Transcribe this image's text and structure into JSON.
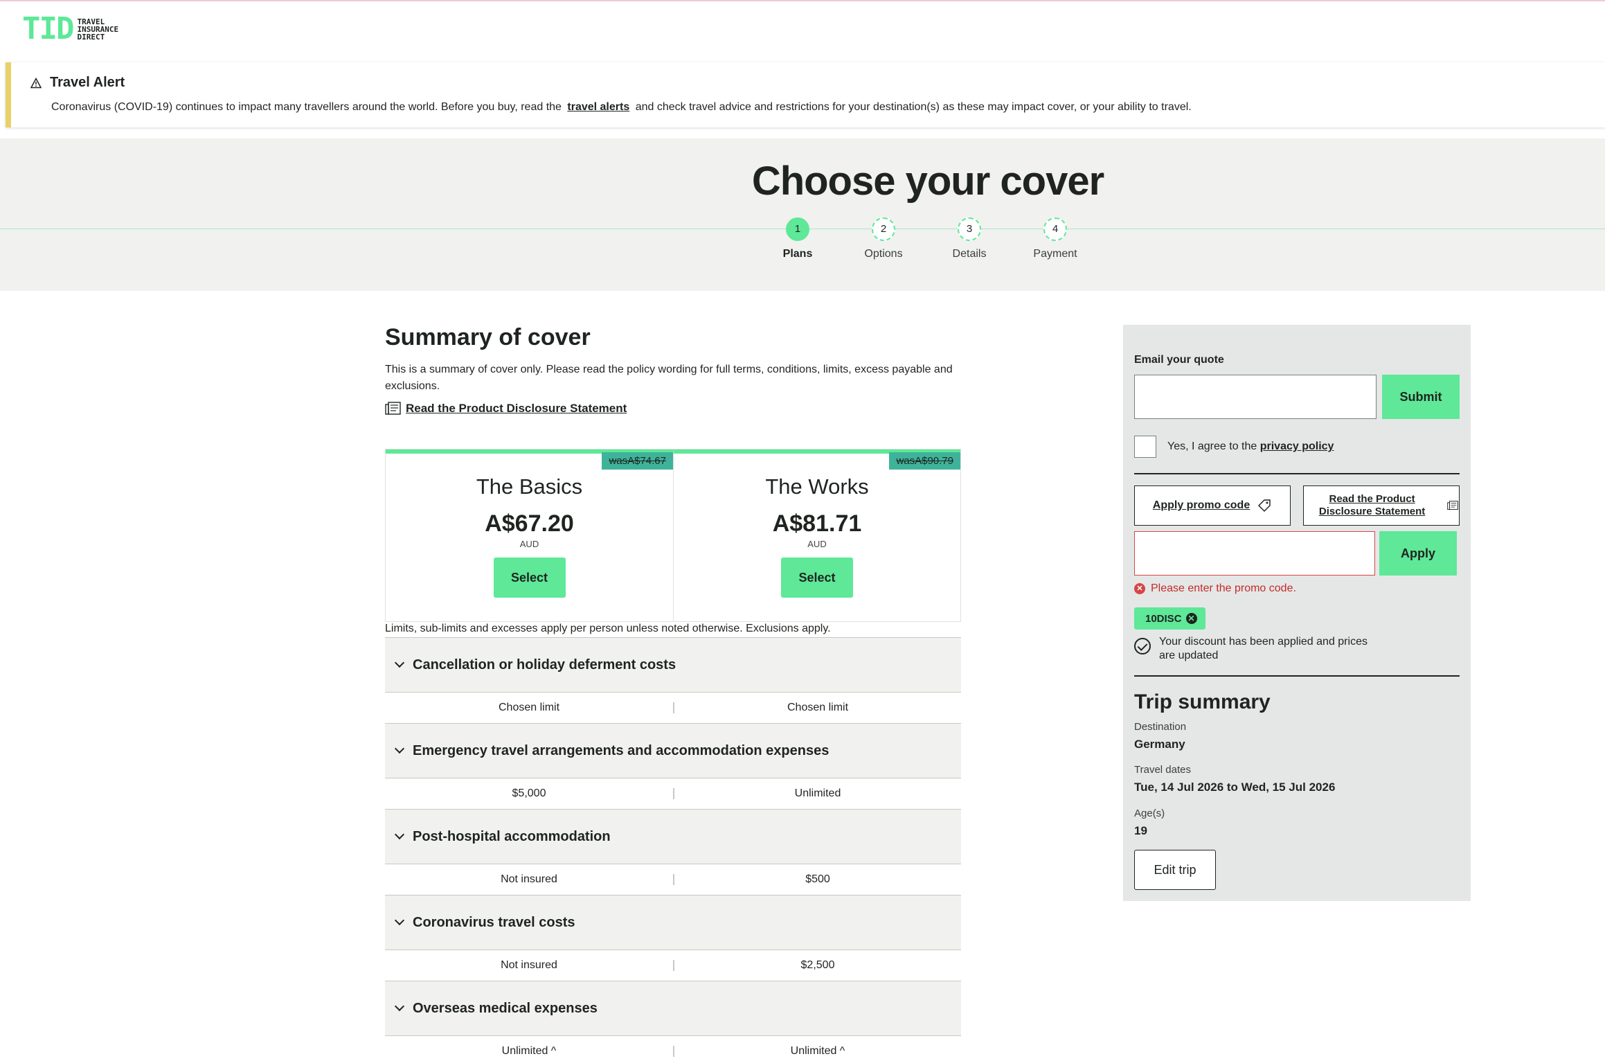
{
  "logo": {
    "mark": "TID",
    "line1": "TRAVEL",
    "line2": "INSURANCE",
    "line3": "DIRECT"
  },
  "alert": {
    "title": "Travel Alert",
    "text_before": "Coronavirus (COVID-19) continues to impact many travellers around the world. Before you buy, read the",
    "link": "travel alerts",
    "text_after": "and check travel advice and restrictions for your destination(s) as these may impact cover, or your ability to travel."
  },
  "page_title": "Choose your cover",
  "steps": [
    {
      "num": "1",
      "label": "Plans"
    },
    {
      "num": "2",
      "label": "Options"
    },
    {
      "num": "3",
      "label": "Details"
    },
    {
      "num": "4",
      "label": "Payment"
    }
  ],
  "summary": {
    "title": "Summary of cover",
    "text": "This is a summary of cover only. Please read the policy wording for full terms, conditions, limits, excess payable and exclusions.",
    "pds_link": "Read the Product Disclosure Statement"
  },
  "plans": [
    {
      "was": "wasA$74.67",
      "name": "The Basics",
      "price": "A$67.20",
      "currency": "AUD",
      "select": "Select"
    },
    {
      "was": "wasA$90.79",
      "name": "The Works",
      "price": "A$81.71",
      "currency": "AUD",
      "select": "Select"
    }
  ],
  "limits_note": "Limits, sub-limits and excesses apply per person unless noted otherwise. Exclusions apply.",
  "cover_items": [
    {
      "title": "Cancellation or holiday deferment costs",
      "basics": "Chosen limit",
      "works": "Chosen limit"
    },
    {
      "title": "Emergency travel arrangements and accommodation expenses",
      "basics": "$5,000",
      "works": "Unlimited"
    },
    {
      "title": "Post-hospital accommodation",
      "basics": "Not insured",
      "works": "$500"
    },
    {
      "title": "Coronavirus travel costs",
      "basics": "Not insured",
      "works": "$2,500"
    },
    {
      "title": "Overseas medical expenses",
      "basics": "Unlimited ^",
      "works": "Unlimited ^"
    }
  ],
  "sidebar": {
    "email_label": "Email your quote",
    "submit": "Submit",
    "agree_text": "Yes, I agree to the",
    "privacy_link": "privacy policy",
    "promo_button": "Apply promo code",
    "pds_button": "Read the Product Disclosure Statement",
    "apply": "Apply",
    "error": "Please enter the promo code.",
    "chip": "10DISC",
    "discount_msg": "Your discount has been applied and prices are updated",
    "trip_title": "Trip summary",
    "destination_label": "Destination",
    "destination": "Germany",
    "dates_label": "Travel dates",
    "dates": "Tue, 14 Jul 2026 to Wed, 15 Jul 2026",
    "ages_label": "Age(s)",
    "ages": "19",
    "edit": "Edit trip"
  },
  "colors": {
    "accent": "#5ee898",
    "alert": "#e8d268",
    "was_badge": "#3fb39a",
    "error": "#d64545"
  }
}
